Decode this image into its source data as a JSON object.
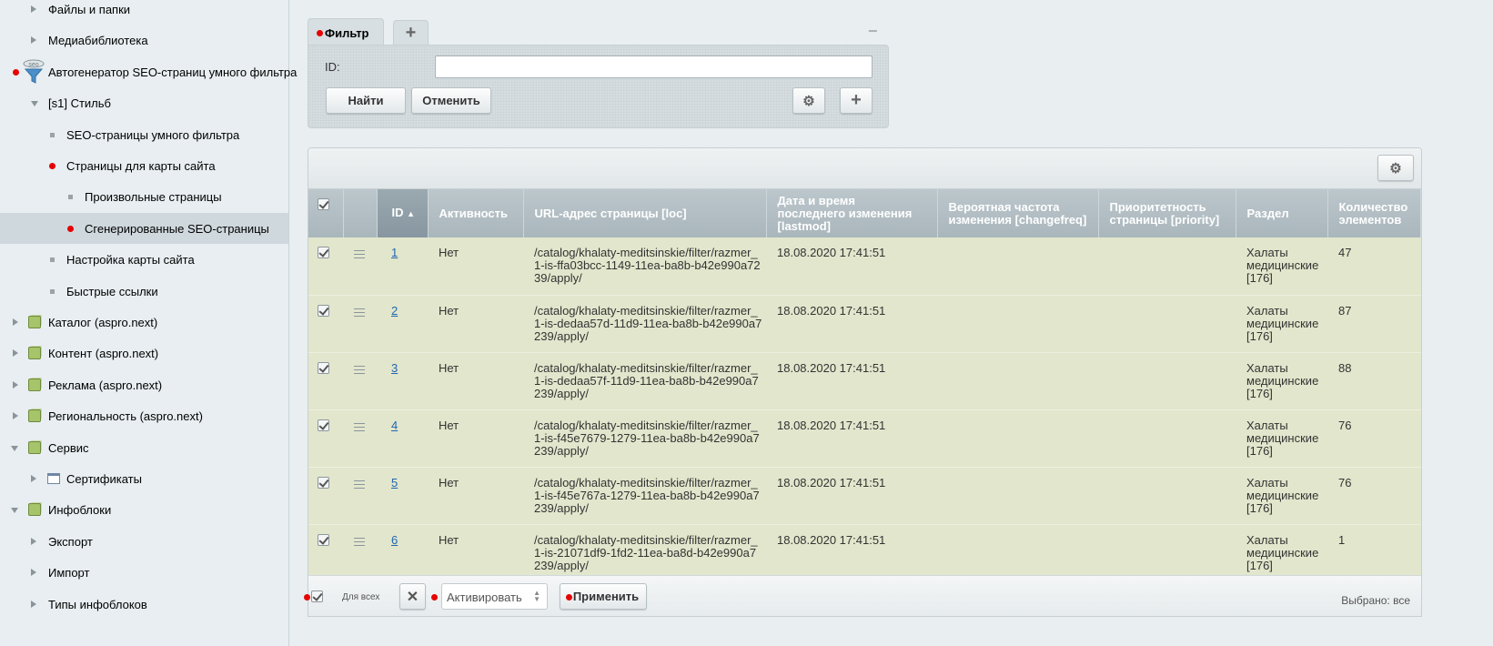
{
  "sidebar": {
    "items": [
      {
        "label": "Файлы и папки",
        "level": 1,
        "marker": "tri-r",
        "icon": ""
      },
      {
        "label": "Медиабиблиотека",
        "level": 1,
        "marker": "tri-r",
        "icon": ""
      },
      {
        "label": "Автогенератор SEO-страниц умного фильтра",
        "level": 0,
        "marker": "red",
        "icon": "seo-filter"
      },
      {
        "label": "[s1] Стильб",
        "level": 1,
        "marker": "tri-d",
        "icon": ""
      },
      {
        "label": "SEO-страницы умного фильтра",
        "level": 2,
        "marker": "sq",
        "icon": ""
      },
      {
        "label": "Страницы для карты сайта",
        "level": 2,
        "marker": "red",
        "icon": ""
      },
      {
        "label": "Произвольные страницы",
        "level": 3,
        "marker": "sq",
        "icon": ""
      },
      {
        "label": "Сгенерированные SEO-страницы",
        "level": 3,
        "marker": "red",
        "icon": "",
        "active": true
      },
      {
        "label": "Настройка карты сайта",
        "level": 2,
        "marker": "sq",
        "icon": ""
      },
      {
        "label": "Быстрые ссылки",
        "level": 2,
        "marker": "sq",
        "icon": ""
      },
      {
        "label": "Каталог (aspro.next)",
        "level": 0,
        "marker": "tri-r",
        "icon": "module"
      },
      {
        "label": "Контент (aspro.next)",
        "level": 0,
        "marker": "tri-r",
        "icon": "module"
      },
      {
        "label": "Реклама (aspro.next)",
        "level": 0,
        "marker": "tri-r",
        "icon": "module"
      },
      {
        "label": "Региональность (aspro.next)",
        "level": 0,
        "marker": "tri-r",
        "icon": "module"
      },
      {
        "label": "Сервис",
        "level": 0,
        "marker": "tri-d",
        "icon": "module"
      },
      {
        "label": "Сертификаты",
        "level": 1,
        "marker": "tri-r",
        "icon": "cert"
      },
      {
        "label": "Инфоблоки",
        "level": 0,
        "marker": "tri-d",
        "icon": "module"
      },
      {
        "label": "Экспорт",
        "level": 1,
        "marker": "tri-r",
        "icon": ""
      },
      {
        "label": "Импорт",
        "level": 1,
        "marker": "tri-r",
        "icon": ""
      },
      {
        "label": "Типы инфоблоков",
        "level": 1,
        "marker": "tri-r",
        "icon": ""
      }
    ]
  },
  "filter": {
    "tab_label": "Фильтр",
    "add_tab": "+",
    "minimize": "−",
    "id_label": "ID:",
    "id_value": "",
    "find_label": "Найти",
    "cancel_label": "Отменить",
    "add_label": "+"
  },
  "grid": {
    "columns": [
      "ID",
      "Активность",
      "URL-адрес страницы [loc]",
      "Дата и время последнего изменения [lastmod]",
      "Вероятная частота изменения [changefreq]",
      "Приоритетность страницы [priority]",
      "Раздел",
      "Количество элементов"
    ],
    "sort_indicator": "▲",
    "rows": [
      {
        "id": "1",
        "active": "Нет",
        "url": "/catalog/khalaty-meditsinskie/filter/razmer_1-is-ffa03bcc-1149-11ea-ba8b-b42e990a7239/apply/",
        "date": "18.08.2020 17:41:51",
        "freq": "",
        "priority": "",
        "section": "Халаты медицинские [176]",
        "count": "47"
      },
      {
        "id": "2",
        "active": "Нет",
        "url": "/catalog/khalaty-meditsinskie/filter/razmer_1-is-dedaa57d-11d9-11ea-ba8b-b42e990a7239/apply/",
        "date": "18.08.2020 17:41:51",
        "freq": "",
        "priority": "",
        "section": "Халаты медицинские [176]",
        "count": "87"
      },
      {
        "id": "3",
        "active": "Нет",
        "url": "/catalog/khalaty-meditsinskie/filter/razmer_1-is-dedaa57f-11d9-11ea-ba8b-b42e990a7239/apply/",
        "date": "18.08.2020 17:41:51",
        "freq": "",
        "priority": "",
        "section": "Халаты медицинские [176]",
        "count": "88"
      },
      {
        "id": "4",
        "active": "Нет",
        "url": "/catalog/khalaty-meditsinskie/filter/razmer_1-is-f45e7679-1279-11ea-ba8b-b42e990a7239/apply/",
        "date": "18.08.2020 17:41:51",
        "freq": "",
        "priority": "",
        "section": "Халаты медицинские [176]",
        "count": "76"
      },
      {
        "id": "5",
        "active": "Нет",
        "url": "/catalog/khalaty-meditsinskie/filter/razmer_1-is-f45e767a-1279-11ea-ba8b-b42e990a7239/apply/",
        "date": "18.08.2020 17:41:51",
        "freq": "",
        "priority": "",
        "section": "Халаты медицинские [176]",
        "count": "76"
      },
      {
        "id": "6",
        "active": "Нет",
        "url": "/catalog/khalaty-meditsinskie/filter/razmer_1-is-21071df9-1fd2-11ea-ba8d-b42e990a7239/apply/",
        "date": "18.08.2020 17:41:51",
        "freq": "",
        "priority": "",
        "section": "Халаты медицинские [176]",
        "count": "1"
      }
    ]
  },
  "footer": {
    "for_all": "Для всех",
    "action_value": "Активировать",
    "apply_label": "Применить",
    "selected": "Выбрано: все"
  }
}
